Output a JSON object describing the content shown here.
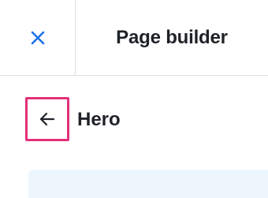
{
  "header": {
    "close_icon": "close-icon",
    "title": "Page builder"
  },
  "section": {
    "back_icon": "arrow-left-icon",
    "title": "Hero"
  },
  "colors": {
    "accent": "#1a73e8",
    "highlight_border": "#e3307a",
    "panel_bg": "#eef6fd",
    "divider": "#dcdfe4"
  }
}
